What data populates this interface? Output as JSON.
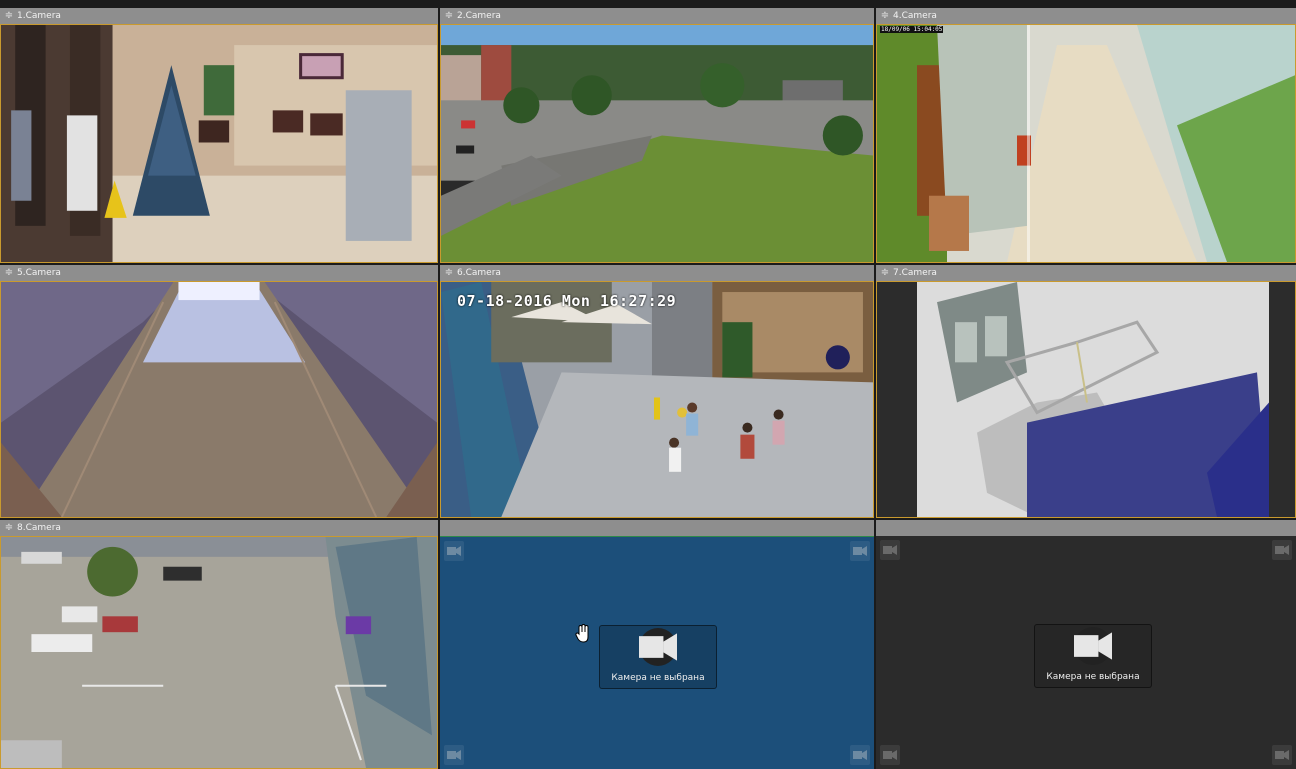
{
  "layout": {
    "cells": [
      {
        "id": "cell-1",
        "camera_label": "1.Camera",
        "state": "live"
      },
      {
        "id": "cell-2",
        "camera_label": "2.Camera",
        "state": "live"
      },
      {
        "id": "cell-4",
        "camera_label": "4.Camera",
        "state": "live",
        "osd_text": "18/09/06 15:04:05"
      },
      {
        "id": "cell-5",
        "camera_label": "5.Camera",
        "state": "live"
      },
      {
        "id": "cell-6",
        "camera_label": "6.Camera",
        "state": "live",
        "osd_text": "07-18-2016 Mon 16:27:29"
      },
      {
        "id": "cell-7",
        "camera_label": "7.Camera",
        "state": "live"
      },
      {
        "id": "cell-8",
        "camera_label": "8.Camera",
        "state": "live"
      },
      {
        "id": "cell-empty-1",
        "camera_label": "",
        "state": "empty",
        "selected": true,
        "empty_text": "Камера не выбрана"
      },
      {
        "id": "cell-empty-2",
        "camera_label": "",
        "state": "empty",
        "selected": false,
        "empty_text": "Камера не выбрана"
      }
    ]
  },
  "colors": {
    "header_bg": "#8e8e8e",
    "active_border": "#c99a2e",
    "selected_cell_bg": "#1c4f7a",
    "empty_cell_bg": "#2b2b2b"
  },
  "icons": {
    "header_menu": "menu-icon",
    "camera": "camera-icon",
    "cursor": "hand-cursor-icon"
  }
}
